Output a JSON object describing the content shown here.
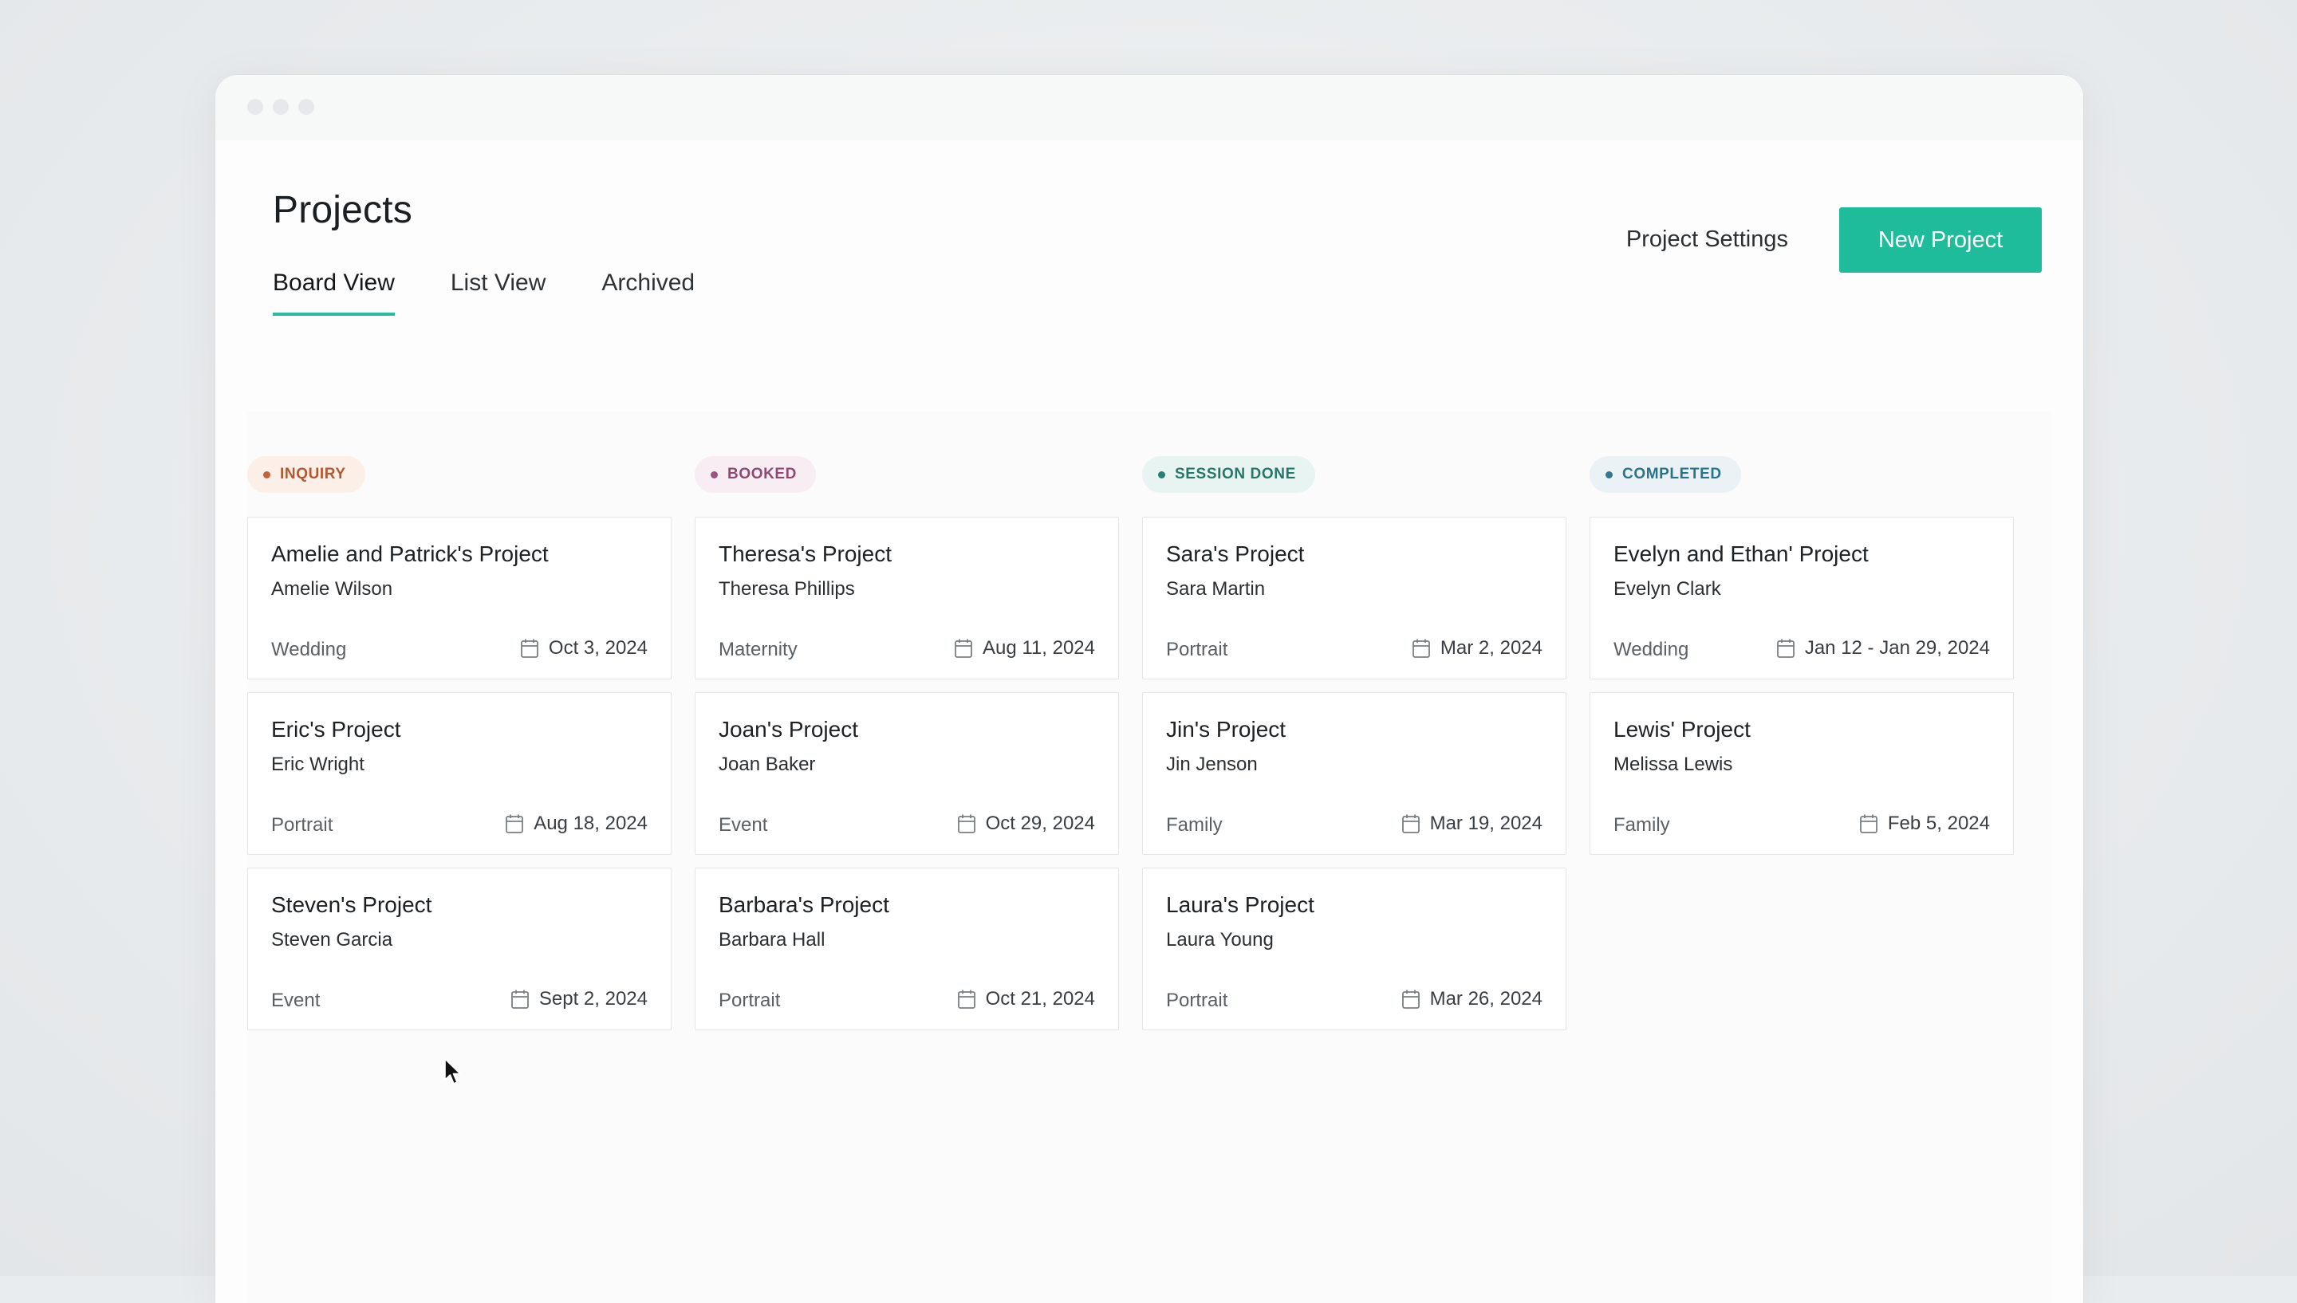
{
  "page": {
    "title": "Projects"
  },
  "tabs": [
    {
      "label": "Board View",
      "active": true
    },
    {
      "label": "List View",
      "active": false
    },
    {
      "label": "Archived",
      "active": false
    }
  ],
  "actions": {
    "settings_label": "Project Settings",
    "new_project_label": "New Project"
  },
  "colors": {
    "accent": "#1fbc9c",
    "inquiry": "#c0633c",
    "booked": "#9b5480",
    "session_done": "#2a7f72",
    "completed": "#2f7a8e"
  },
  "columns": [
    {
      "status": "INQUIRY",
      "cards": [
        {
          "title": "Amelie and Patrick's Project",
          "client": "Amelie Wilson",
          "type": "Wedding",
          "date": "Oct 3, 2024"
        },
        {
          "title": "Eric's Project",
          "client": "Eric Wright",
          "type": "Portrait",
          "date": "Aug 18, 2024"
        },
        {
          "title": "Steven's Project",
          "client": "Steven Garcia",
          "type": "Event",
          "date": "Sept 2, 2024"
        }
      ]
    },
    {
      "status": "BOOKED",
      "cards": [
        {
          "title": "Theresa's Project",
          "client": "Theresa Phillips",
          "type": "Maternity",
          "date": "Aug 11, 2024"
        },
        {
          "title": "Joan's Project",
          "client": "Joan Baker",
          "type": "Event",
          "date": "Oct 29, 2024"
        },
        {
          "title": "Barbara's Project",
          "client": "Barbara Hall",
          "type": "Portrait",
          "date": "Oct 21, 2024"
        }
      ]
    },
    {
      "status": "SESSION DONE",
      "cards": [
        {
          "title": "Sara's Project",
          "client": "Sara Martin",
          "type": "Portrait",
          "date": "Mar 2, 2024"
        },
        {
          "title": "Jin's Project",
          "client": "Jin Jenson",
          "type": "Family",
          "date": "Mar 19, 2024"
        },
        {
          "title": "Laura's Project",
          "client": "Laura Young",
          "type": "Portrait",
          "date": "Mar 26, 2024"
        }
      ]
    },
    {
      "status": "COMPLETED",
      "cards": [
        {
          "title": "Evelyn and Ethan' Project",
          "client": "Evelyn Clark",
          "type": "Wedding",
          "date": "Jan 12 - Jan 29, 2024"
        },
        {
          "title": "Lewis' Project",
          "client": "Melissa Lewis",
          "type": "Family",
          "date": "Feb 5, 2024"
        }
      ]
    }
  ]
}
